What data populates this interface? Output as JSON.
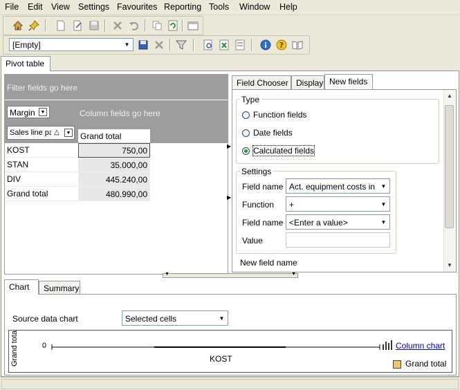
{
  "menu": [
    "File",
    "Edit",
    "View",
    "Settings",
    "Favourites",
    "Reporting",
    "Tools",
    "Window",
    "Help"
  ],
  "toolbar2": {
    "combo_value": "[Empty]"
  },
  "main_tab": "Pivot table",
  "pivot": {
    "filter_hint": "Filter fields go here",
    "column_hint": "Column fields go here",
    "data_field": "Margin",
    "row_field": "Sales line pa",
    "column_header": "Grand total",
    "rows": [
      {
        "label": "KOST",
        "value": "750,00"
      },
      {
        "label": "STAN",
        "value": "35.000,00"
      },
      {
        "label": "DIV",
        "value": "445.240,00"
      },
      {
        "label": "Grand total",
        "value": "480.990,00"
      }
    ]
  },
  "right_tabs": [
    "Field Chooser",
    "Display",
    "New fields"
  ],
  "new_fields": {
    "type_group": "Type",
    "type_options": [
      "Function fields",
      "Date fields",
      "Calculated fields"
    ],
    "selected_type": "Calculated fields",
    "settings_group": "Settings",
    "field_name_label": "Field name",
    "field_name_value": "Act. equipment costs in",
    "function_label": "Function",
    "function_value": "+",
    "field_name2_label": "Field name",
    "field_name2_value": "<Enter a value>",
    "value_label": "Value",
    "value_value": "",
    "new_field_name_label": "New field name"
  },
  "bottom_tabs": [
    "Chart",
    "Summary"
  ],
  "chart_panel": {
    "source_label": "Source data chart",
    "source_value": "Selected cells",
    "link": "Column chart"
  },
  "chart_data": {
    "type": "bar",
    "categories": [
      "KOST"
    ],
    "series": [
      {
        "name": "Grand total",
        "values": [
          0
        ]
      }
    ],
    "ylabel": "Grand tota",
    "y_tick": "0",
    "legend_color": "#f5c46c"
  }
}
